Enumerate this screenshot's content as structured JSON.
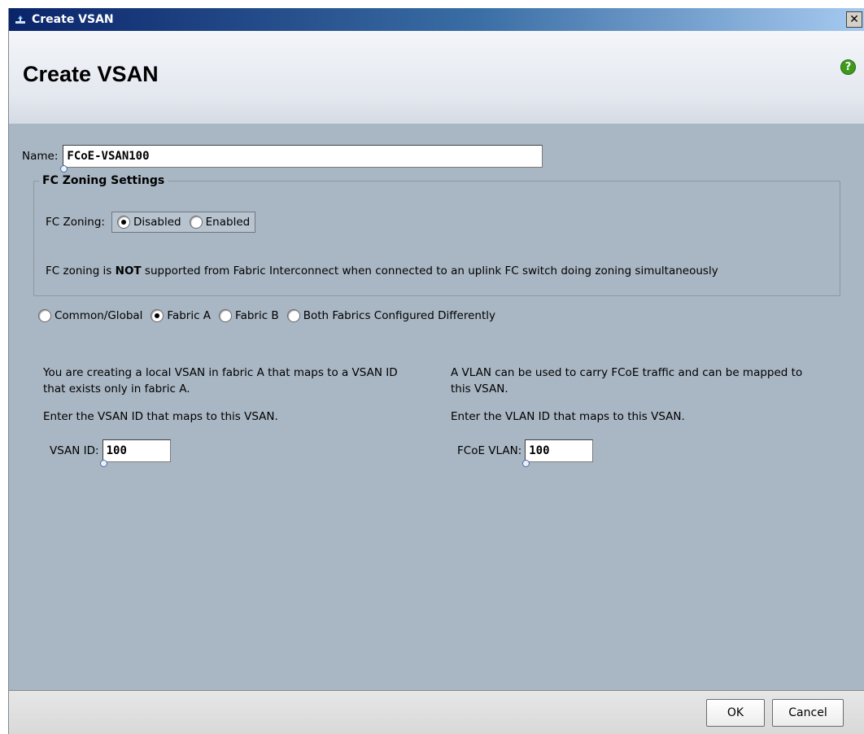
{
  "window": {
    "title": "Create VSAN",
    "close_glyph": "✕"
  },
  "header": {
    "title": "Create VSAN",
    "help_glyph": "?"
  },
  "form": {
    "name_label": "Name:",
    "name_value": "FCoE-VSAN100",
    "zoning": {
      "legend": "FC Zoning Settings",
      "label": "FC Zoning:",
      "options": [
        "Disabled",
        "Enabled"
      ],
      "selected": "Disabled",
      "note_prefix": "FC zoning is ",
      "note_emphasis": "NOT",
      "note_suffix": " supported from Fabric Interconnect when connected to an uplink FC switch doing zoning simultaneously"
    },
    "scope": {
      "options": [
        "Common/Global",
        "Fabric A",
        "Fabric B",
        "Both Fabrics Configured Differently"
      ],
      "selected": "Fabric A"
    },
    "vsan": {
      "description": "You are creating a local VSAN in fabric A that maps to a VSAN ID that exists only in fabric A.",
      "instruction": "Enter the VSAN ID that maps to this VSAN.",
      "id_label": "VSAN ID:",
      "id_value": "100"
    },
    "vlan": {
      "description": "A VLAN can be used to carry FCoE traffic and can be mapped to this VSAN.",
      "instruction": "Enter the VLAN ID that maps to this VSAN.",
      "id_label": "FCoE VLAN:",
      "id_value": "100"
    }
  },
  "buttons": {
    "ok": "OK",
    "cancel": "Cancel"
  },
  "icons": {
    "app": "wrench-icon",
    "close": "close-icon",
    "help": "help-icon"
  },
  "colors": {
    "panel_bg": "#a9b6c3",
    "title_bar_start": "#0a246a",
    "help_green": "#3d9a1d"
  }
}
